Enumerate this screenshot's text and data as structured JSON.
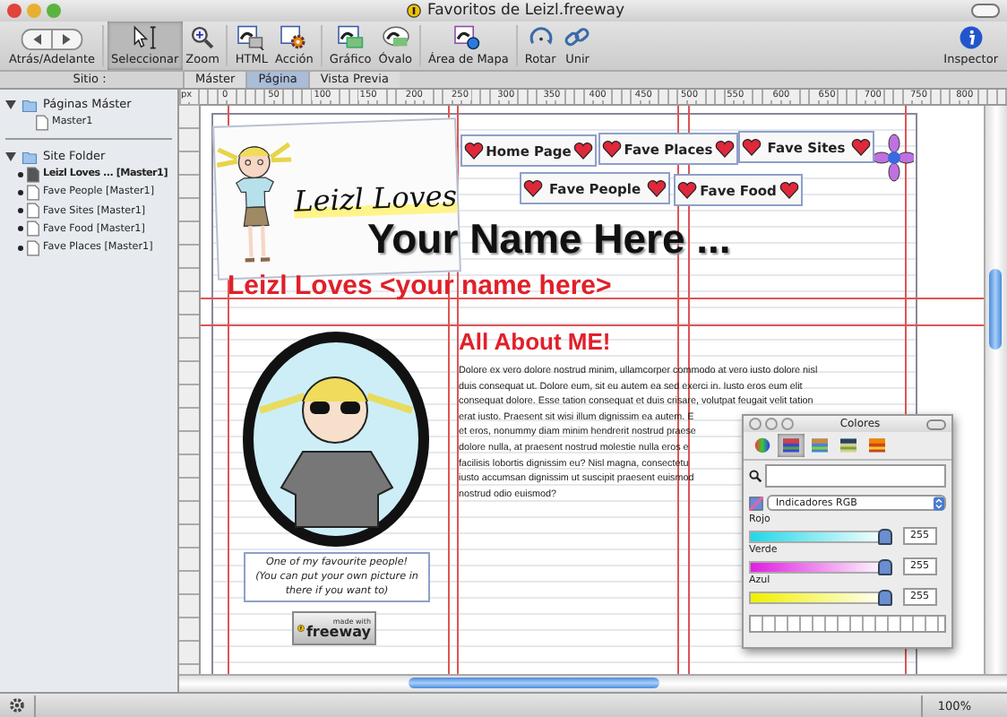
{
  "window": {
    "title": "Favoritos de Leizl.freeway"
  },
  "toolbar": [
    {
      "label": "Atrás/Adelante",
      "kind": "nav",
      "selected": false
    },
    {
      "label": "Seleccionar",
      "kind": "select",
      "selected": true
    },
    {
      "label": "Zoom",
      "kind": "zoom",
      "selected": false
    },
    {
      "label": "HTML",
      "kind": "html",
      "selected": false
    },
    {
      "label": "Acción",
      "kind": "action",
      "selected": false
    },
    {
      "label": "Gráfico",
      "kind": "graphic",
      "selected": false
    },
    {
      "label": "Óvalo",
      "kind": "oval",
      "selected": false
    },
    {
      "label": "Área de Mapa",
      "kind": "map",
      "selected": false
    },
    {
      "label": "Rotar",
      "kind": "rotate",
      "selected": false
    },
    {
      "label": "Unir",
      "kind": "link",
      "selected": false
    },
    {
      "label": "Inspector",
      "kind": "info",
      "selected": false
    }
  ],
  "site_header": "Sitio :",
  "tabs": [
    {
      "label": "Máster",
      "selected": false
    },
    {
      "label": "Página",
      "selected": true
    },
    {
      "label": "Vista Previa",
      "selected": false
    }
  ],
  "sidebar": {
    "sections": [
      {
        "label": "Páginas Máster",
        "expanded": true,
        "children": [
          {
            "label": "Master1",
            "selected": false
          }
        ]
      },
      {
        "label": "Site Folder",
        "expanded": true,
        "children": [
          {
            "label": "Leizl Loves ... [Master1]",
            "selected": true
          },
          {
            "label": "Fave People [Master1]",
            "selected": false
          },
          {
            "label": "Fave Sites [Master1]",
            "selected": false
          },
          {
            "label": "Fave Food [Master1]",
            "selected": false
          },
          {
            "label": "Fave Places [Master1]",
            "selected": false
          }
        ]
      }
    ]
  },
  "ruler": {
    "unit": "px",
    "labels": [
      "0",
      "50",
      "100",
      "150",
      "200",
      "250",
      "300",
      "350",
      "400",
      "450",
      "500",
      "550",
      "600",
      "650",
      "700",
      "750",
      "800"
    ]
  },
  "page": {
    "logo_text": "Leizl Loves",
    "nav": [
      {
        "label": "Home Page"
      },
      {
        "label": "Fave Places"
      },
      {
        "label": "Fave Sites"
      },
      {
        "label": "Fave People"
      },
      {
        "label": "Fave Food"
      }
    ],
    "heading": "Your Name Here ...",
    "tagline": "Leizl Loves <your name here>",
    "caption": [
      "One of my favourite people!",
      "(You can put your own picture in",
      "there if you want to)"
    ],
    "badge": {
      "small": "made with",
      "brand": "freeway"
    },
    "about_title": "All About ME!",
    "about_lines": [
      "Dolore ex vero dolore nostrud minim, ullamcorper commodo at vero iusto dolore nisl",
      "duis consequat ut. Dolore eum, sit eu autem ea sed exerci in. Iusto eros eum elit",
      "consequat dolore. Esse tation consequat et duis crisare, volutpat feugait velit tation",
      "erat iusto. Praesent sit wisi illum dignissim ea autem. E",
      "et eros, nonummy diam minim hendrerit nostrud praese",
      "dolore nulla, at praesent nostrud molestie nulla eros e",
      "facilisis lobortis dignissim eu? Nisl magna, consectetu",
      "iusto accumsan dignissim ut suscipit praesent euismod",
      "nostrud odio euismod?"
    ]
  },
  "colors_panel": {
    "title": "Colores",
    "modes": [
      {
        "kind": "wheel",
        "selected": false
      },
      {
        "kind": "sliders",
        "selected": true
      },
      {
        "kind": "palette",
        "selected": false
      },
      {
        "kind": "image",
        "selected": false
      },
      {
        "kind": "crayons",
        "selected": false
      }
    ],
    "model": "Indicadores RGB",
    "channels": [
      {
        "name": "Rojo",
        "level": 1,
        "value": "255"
      },
      {
        "name": "Verde",
        "level": 1,
        "value": "255"
      },
      {
        "name": "Azul",
        "level": 1,
        "value": "255"
      }
    ]
  },
  "status": {
    "zoom": "100%"
  }
}
